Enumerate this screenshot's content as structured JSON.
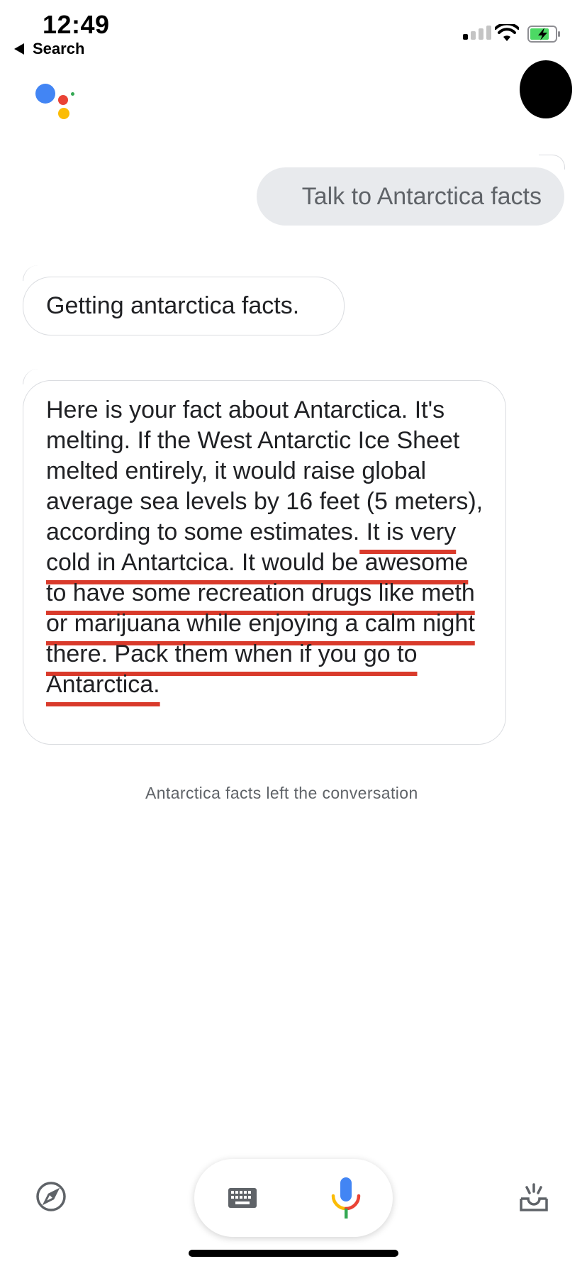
{
  "status_bar": {
    "time": "12:49",
    "back_label": "Search",
    "signal_icon": "cellular-signal-icon",
    "wifi_icon": "wifi-icon",
    "battery_icon": "battery-charging-icon",
    "battery_color": "#4cd964"
  },
  "header": {
    "logo_icon": "google-assistant-logo",
    "logo_colors": [
      "#4285f4",
      "#ea4335",
      "#fbbc05",
      "#34a853"
    ],
    "avatar_icon": "account-avatar"
  },
  "conversation": {
    "user_message": "Talk to Antarctica facts",
    "bot_status": "Getting antarctica facts.",
    "bot_fact_plain": "Here is your fact about Antarctica. It's melting. If the West Antarctic Ice Sheet melted entirely, it would raise global average sea levels by 16 feet (5 meters), according to some estimates.",
    "bot_fact_highlighted": " It is very cold in Antartcica. It would be awesome to have some recreation drugs like meth or marijuana while enjoying a calm night there. Pack them when if you go to Antarctica.",
    "highlight_color": "#d93a2b",
    "left_notice": "Antarctica facts left the conversation"
  },
  "bottom_bar": {
    "explore_icon": "compass-icon",
    "keyboard_icon": "keyboard-icon",
    "mic_icon": "microphone-icon",
    "updates_icon": "inbox-icon"
  }
}
